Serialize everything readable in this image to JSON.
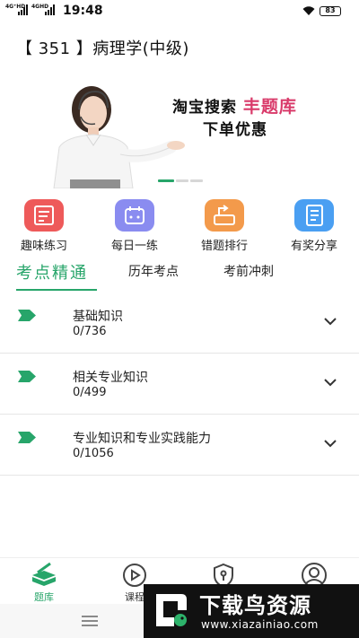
{
  "status_bar": {
    "net1": "4G⁺HD",
    "net2": "4GHD",
    "time": "19:48",
    "battery": "83"
  },
  "title": "【 351 】病理学(中级)",
  "banner": {
    "line1_prefix": "淘宝搜索 ",
    "line1_highlight": "丰题库",
    "line2": "下单优惠",
    "slide_count": 3,
    "active_slide": 1
  },
  "quick_actions": [
    {
      "label": "趣味练习",
      "icon": "practice-icon",
      "color": "#ee5a5a"
    },
    {
      "label": "每日一练",
      "icon": "daily-icon",
      "color": "#8a8cf0"
    },
    {
      "label": "错题排行",
      "icon": "ranking-icon",
      "color": "#f39a4b"
    },
    {
      "label": "有奖分享",
      "icon": "share-icon",
      "color": "#4a9ff2"
    }
  ],
  "tabs": [
    {
      "label": "考点精通",
      "active": true
    },
    {
      "label": "历年考点",
      "active": false
    },
    {
      "label": "考前冲刺",
      "active": false
    }
  ],
  "sections": [
    {
      "title": "基础知识",
      "count": "0/736"
    },
    {
      "title": "相关专业知识",
      "count": "0/499"
    },
    {
      "title": "专业知识和专业实践能力",
      "count": "0/1056"
    }
  ],
  "bottom_nav": [
    {
      "label": "题库",
      "icon": "question-bank-icon",
      "active": true
    },
    {
      "label": "课程",
      "icon": "play-icon",
      "active": false
    },
    {
      "label": "",
      "icon": "shield-icon",
      "active": false
    },
    {
      "label": "",
      "icon": "profile-icon",
      "active": false
    }
  ],
  "watermark": {
    "title": "下载鸟资源",
    "url": "www.xiazainiao.com"
  },
  "colors": {
    "accent": "#27a56a",
    "highlight": "#d93a6a"
  }
}
